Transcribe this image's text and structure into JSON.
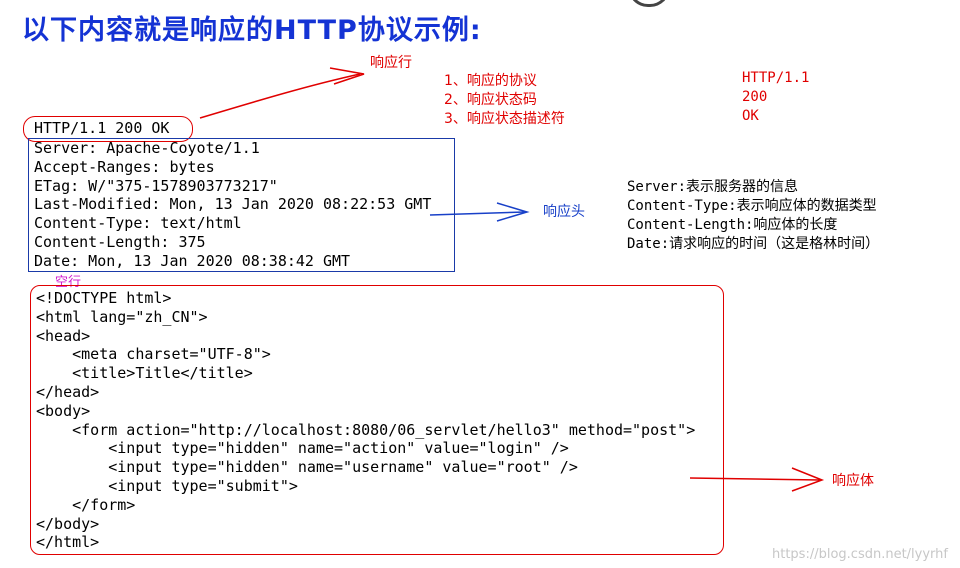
{
  "title": "以下内容就是响应的HTTP协议示例:",
  "labels": {
    "status_line": "响应行",
    "headers": "响应头",
    "blank_line": "空行",
    "body": "响应体"
  },
  "status_parts": [
    {
      "name": "1、响应的协议",
      "value": "HTTP/1.1"
    },
    {
      "name": "2、响应状态码",
      "value": "200"
    },
    {
      "name": "3、响应状态描述符",
      "value": "OK"
    }
  ],
  "status_line": "HTTP/1.1 200 OK",
  "headers": [
    "Server: Apache-Coyote/1.1",
    "Accept-Ranges: bytes",
    "ETag: W/\"375-1578903773217\"",
    "Last-Modified: Mon, 13 Jan 2020 08:22:53 GMT",
    "Content-Type: text/html",
    "Content-Length: 375",
    "Date: Mon, 13 Jan 2020 08:38:42 GMT"
  ],
  "header_notes": [
    "Server:表示服务器的信息",
    "Content-Type:表示响应体的数据类型",
    "Content-Length:响应体的长度",
    "Date:请求响应的时间（这是格林时间）"
  ],
  "body_lines": [
    "<!DOCTYPE html>",
    "<html lang=\"zh_CN\">",
    "<head>",
    "    <meta charset=\"UTF-8\">",
    "    <title>Title</title>",
    "</head>",
    "<body>",
    "    <form action=\"http://localhost:8080/06_servlet/hello3\" method=\"post\">",
    "        <input type=\"hidden\" name=\"action\" value=\"login\" />",
    "        <input type=\"hidden\" name=\"username\" value=\"root\" />",
    "        <input type=\"submit\">",
    "    </form>",
    "</body>",
    "</html>"
  ],
  "watermark": "https://blog.csdn.net/lyyrhf",
  "colors": {
    "title": "#1433d4",
    "red": "#e00000",
    "blue": "#1840c8"
  }
}
